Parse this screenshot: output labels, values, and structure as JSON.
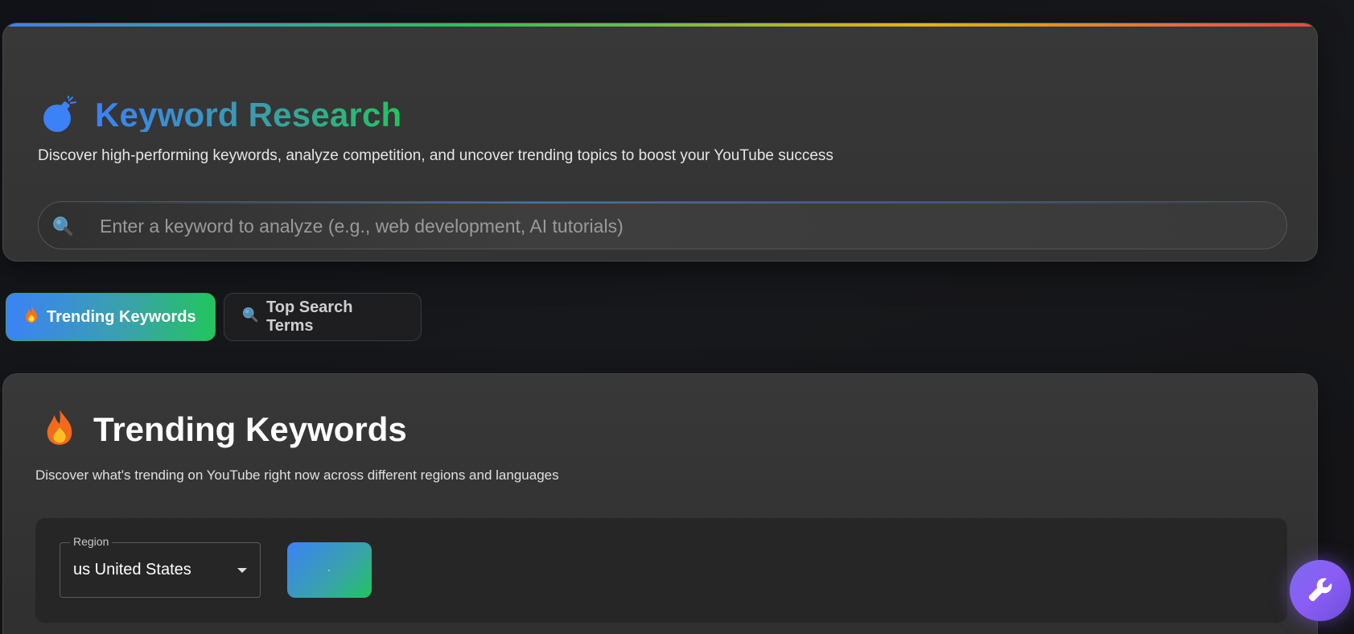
{
  "header": {
    "title": "Keyword Research",
    "subtitle": "Discover high-performing keywords, analyze competition, and uncover trending topics to boost your YouTube success",
    "search": {
      "placeholder": "Enter a keyword to analyze (e.g., web development, AI tutorials)",
      "value": ""
    }
  },
  "tabs": [
    {
      "label": "Trending Keywords",
      "icon": "flame-icon",
      "active": true
    },
    {
      "label": "Top Search Terms",
      "icon": "search-icon",
      "active": false
    }
  ],
  "trending": {
    "title": "Trending Keywords",
    "subtitle": "Discover what's trending on YouTube right now across different regions and languages",
    "region": {
      "label": "Region",
      "value": "us United States"
    }
  },
  "colors": {
    "accent_blue": "#3b82f6",
    "accent_green": "#22c55e",
    "fab_purple": "#8b5cf6",
    "background": "#141518",
    "card": "#383838"
  },
  "icons": {
    "title": "bomb-icon",
    "search": "search-icon",
    "trending": "flame-icon",
    "fab": "wrench-icon"
  }
}
